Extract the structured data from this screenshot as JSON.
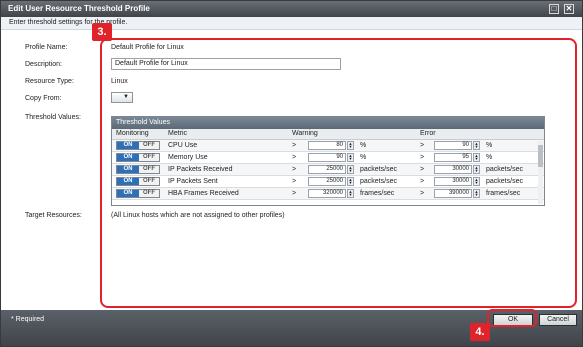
{
  "window": {
    "title": "Edit User Resource Threshold Profile"
  },
  "instruction": "Enter threshold settings for the profile.",
  "form": {
    "profile_name_label": "Profile Name:",
    "profile_name_value": "Default Profile for Linux",
    "description_label": "Description:",
    "description_value": "Default Profile for Linux",
    "resource_type_label": "Resource Type:",
    "resource_type_value": "Linux",
    "copy_from_label": "Copy From:",
    "copy_from_arrow": "▼",
    "threshold_values_label": "Threshold Values:",
    "target_resources_label": "Target Resources:",
    "target_resources_value": "(All Linux hosts which are not assigned to other profiles)"
  },
  "threshold": {
    "title": "Threshold Values",
    "headers": {
      "monitoring": "Monitoring",
      "metric": "Metric",
      "warning": "Warning",
      "error": "Error"
    },
    "toggle_on": "ON",
    "toggle_off": "OFF",
    "rows": [
      {
        "metric": "CPU Use",
        "op": ">",
        "warn": "80",
        "warn_unit": "%",
        "err": "90",
        "err_unit": "%"
      },
      {
        "metric": "Memory Use",
        "op": ">",
        "warn": "90",
        "warn_unit": "%",
        "err": "95",
        "err_unit": "%"
      },
      {
        "metric": "IP Packets Received",
        "op": ">",
        "warn": "25000",
        "warn_unit": "packets/sec",
        "err": "30000",
        "err_unit": "packets/sec"
      },
      {
        "metric": "IP Packets Sent",
        "op": ">",
        "warn": "25000",
        "warn_unit": "packets/sec",
        "err": "30000",
        "err_unit": "packets/sec"
      },
      {
        "metric": "HBA Frames Received",
        "op": ">",
        "warn": "320000",
        "warn_unit": "frames/sec",
        "err": "390000",
        "err_unit": "frames/sec"
      }
    ]
  },
  "callouts": {
    "step3": "3.",
    "step4": "4."
  },
  "footer": {
    "required": "* Required",
    "ok": "OK",
    "cancel": "Cancel"
  },
  "colors": {
    "highlight": "#e0232b",
    "toggle_on": "#2f6fb8"
  }
}
